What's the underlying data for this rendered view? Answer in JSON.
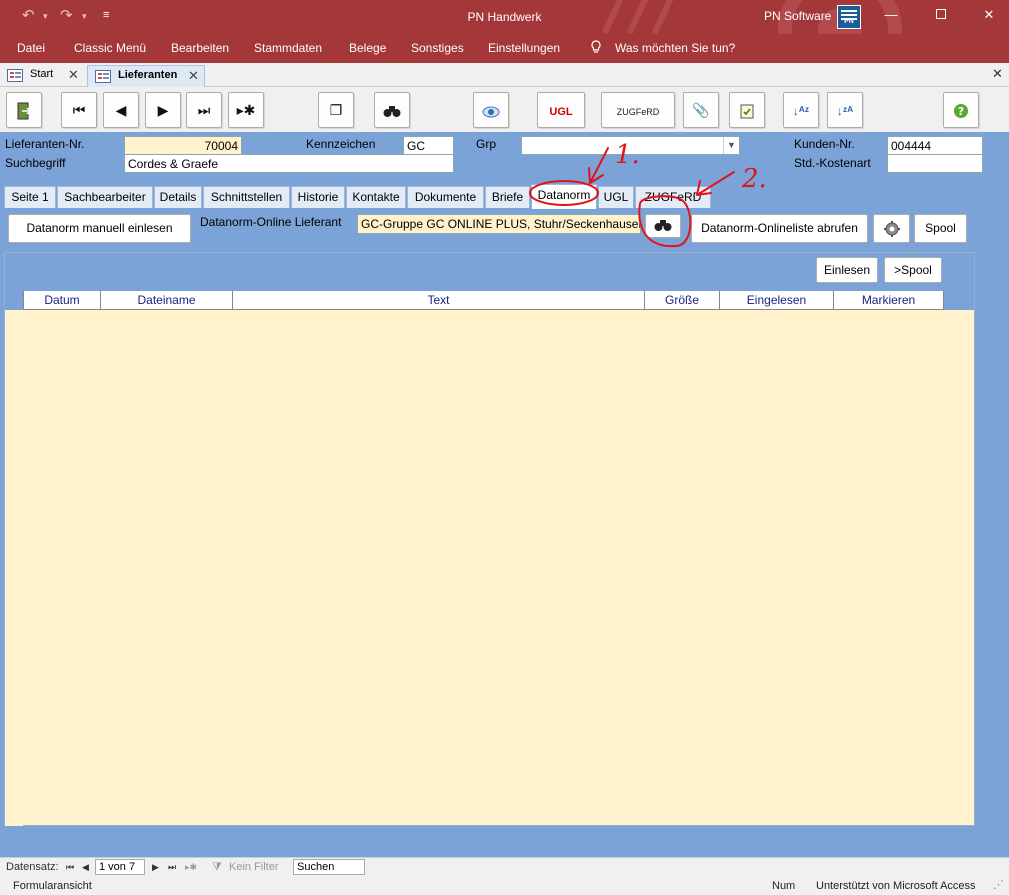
{
  "window": {
    "title": "PN Handwerk",
    "brand": "PN Software",
    "logo_text": "PN Soft"
  },
  "menu": {
    "items": [
      "Datei",
      "Classic Menü",
      "Bearbeiten",
      "Stammdaten",
      "Belege",
      "Sonstiges",
      "Einstellungen"
    ],
    "tell_me": "Was möchten Sie tun?"
  },
  "doc_tabs": [
    {
      "label": "Start",
      "active": false
    },
    {
      "label": "Lieferanten",
      "active": true
    }
  ],
  "toolbar": {
    "ugl_label": "UGL",
    "zugferd_label": "ZUGFeRD"
  },
  "header": {
    "lieferanten_nr_label": "Lieferanten-Nr.",
    "lieferanten_nr": "70004",
    "suchbegriff_label": "Suchbegriff",
    "suchbegriff": "Cordes & Graefe",
    "kennzeichen_label": "Kennzeichen",
    "kennzeichen": "GC",
    "grp_label": "Grp",
    "grp": "",
    "kunden_nr_label": "Kunden-Nr.",
    "kunden_nr": "004444",
    "std_kostenart_label": "Std.-Kostenart",
    "std_kostenart": ""
  },
  "form_tabs": [
    "Seite 1",
    "Sachbearbeiter",
    "Details",
    "Schnittstellen",
    "Historie",
    "Kontakte",
    "Dokumente",
    "Briefe",
    "Datanorm",
    "UGL",
    "ZUGFeRD"
  ],
  "form_tab_selected": "Datanorm",
  "datanorm": {
    "manual_button": "Datanorm manuell einlesen",
    "online_label": "Datanorm-Online Lieferant",
    "online_value": "GC-Gruppe GC ONLINE PLUS, Stuhr/Seckenhausen",
    "fetch_button": "Datanorm-Onlineliste abrufen",
    "spool_button": "Spool",
    "einlesen_button": "Einlesen",
    "to_spool_button": ">Spool",
    "columns": [
      "Datum",
      "Dateiname",
      "Text",
      "Größe",
      "Eingelesen",
      "Markieren"
    ],
    "rows": []
  },
  "navigator": {
    "label": "Datensatz:",
    "position": "1 von 7",
    "filter": "Kein Filter",
    "search": "Suchen"
  },
  "status": {
    "view": "Formularansicht",
    "num": "Num",
    "supported": "Unterstützt von Microsoft Access"
  },
  "annotations": {
    "mark1": "1.",
    "mark2": "2."
  },
  "colors": {
    "title_bar": "#a4373a",
    "form_background": "#7ba3d8",
    "field_highlight": "#fff2cc",
    "annotation": "#e0141a"
  }
}
